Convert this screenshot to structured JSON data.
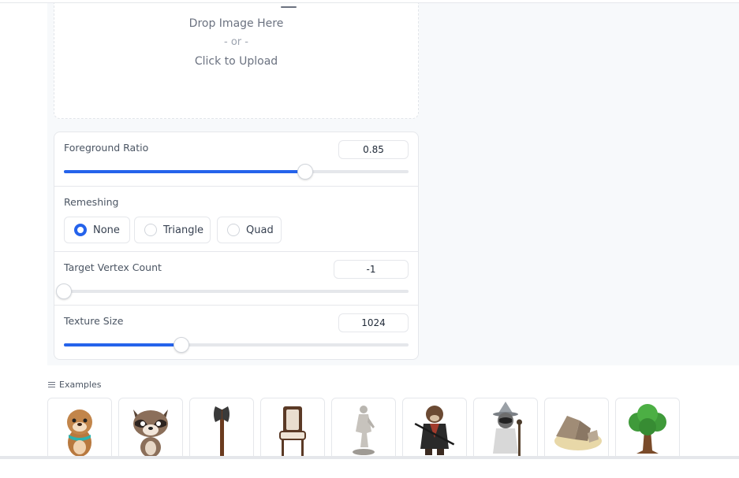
{
  "upload": {
    "drop_text": "Drop Image Here",
    "or_text": "- or -",
    "click_text": "Click to Upload"
  },
  "settings": {
    "foreground_ratio": {
      "label": "Foreground Ratio",
      "value": "0.85",
      "fraction": 0.7
    },
    "remeshing": {
      "label": "Remeshing",
      "options": [
        "None",
        "Triangle",
        "Quad"
      ],
      "selected": "None"
    },
    "target_vertex_count": {
      "label": "Target Vertex Count",
      "value": "-1",
      "fraction": 0.0
    },
    "texture_size": {
      "label": "Texture Size",
      "value": "1024",
      "fraction": 0.34
    }
  },
  "examples": {
    "title": "Examples",
    "items": [
      {
        "icon": "otter-icon"
      },
      {
        "icon": "raccoon-icon"
      },
      {
        "icon": "axe-icon"
      },
      {
        "icon": "chair-icon"
      },
      {
        "icon": "statue-icon"
      },
      {
        "icon": "samurai-otter-icon"
      },
      {
        "icon": "wizard-raccoon-icon"
      },
      {
        "icon": "rocks-icon"
      },
      {
        "icon": "tree-icon"
      }
    ]
  },
  "colors": {
    "accent": "#2563eb",
    "border": "#e5e7eb",
    "panel_bg": "#f7f9fb"
  }
}
